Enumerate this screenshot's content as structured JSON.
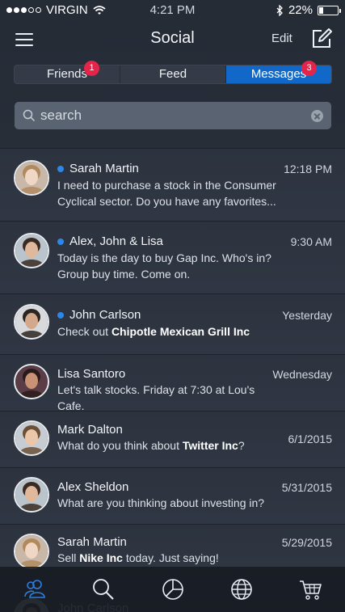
{
  "status_bar": {
    "carrier": "VIRGIN",
    "time": "4:21 PM",
    "battery": "22%",
    "battery_level": 0.22
  },
  "nav": {
    "title": "Social",
    "edit_label": "Edit"
  },
  "segments": [
    {
      "label": "Friends",
      "badge": "1",
      "active": false
    },
    {
      "label": "Feed",
      "badge": "",
      "active": false
    },
    {
      "label": "Messages",
      "badge": "3",
      "active": true
    }
  ],
  "search": {
    "value": "search"
  },
  "messages": [
    {
      "name": "Sarah Martin",
      "unread": true,
      "time": "12:18 PM",
      "preview": [
        "I need to purchase a stock in the Consumer",
        "Cyclical sector. Do you have any favorites..."
      ],
      "bold": "",
      "suffix": "",
      "avatar": "sarah"
    },
    {
      "name": "Alex, John & Lisa",
      "unread": true,
      "time": "9:30 AM",
      "preview": [
        "Today is the day to buy Gap Inc. Who's in?",
        "Group buy time. Come on."
      ],
      "bold": "",
      "suffix": "",
      "avatar": "alex"
    },
    {
      "name": "John Carlson",
      "unread": true,
      "time": "Yesterday",
      "preview": [
        "Check out "
      ],
      "bold": "Chipotle Mexican Grill Inc",
      "suffix": "",
      "avatar": "john"
    },
    {
      "name": "Lisa Santoro",
      "unread": false,
      "time": "Wednesday",
      "preview": [
        "Let's talk stocks. Friday at 7:30 at Lou's Cafe."
      ],
      "bold": "",
      "suffix": "",
      "avatar": "lisa"
    },
    {
      "name": "Mark Dalton",
      "unread": false,
      "time": "6/1/2015",
      "preview": [
        "What do you think about "
      ],
      "bold": "Twitter Inc",
      "suffix": "?",
      "avatar": "mark"
    },
    {
      "name": "Alex Sheldon",
      "unread": false,
      "time": "5/31/2015",
      "preview": [
        "What are you thinking about investing in?"
      ],
      "bold": "",
      "suffix": "",
      "avatar": "alex"
    },
    {
      "name": "Sarah Martin",
      "unread": false,
      "time": "5/29/2015",
      "preview": [
        "Sell "
      ],
      "bold": "Nike Inc",
      "suffix": " today. Just saying!",
      "avatar": "sarah"
    },
    {
      "name": "John Carlson",
      "unread": false,
      "time": "",
      "preview": [
        ""
      ],
      "bold": "",
      "suffix": "",
      "avatar": "john"
    }
  ],
  "tabbar": [
    {
      "icon": "people-icon",
      "active": true
    },
    {
      "icon": "search-icon",
      "active": false
    },
    {
      "icon": "pie-chart-icon",
      "active": false
    },
    {
      "icon": "globe-icon",
      "active": false
    },
    {
      "icon": "cart-icon",
      "active": false
    }
  ],
  "colors": {
    "accent": "#1268c8",
    "badge": "#e5244a",
    "unread_dot": "#2d87e6",
    "active_tab_icon": "#2f7de0"
  }
}
